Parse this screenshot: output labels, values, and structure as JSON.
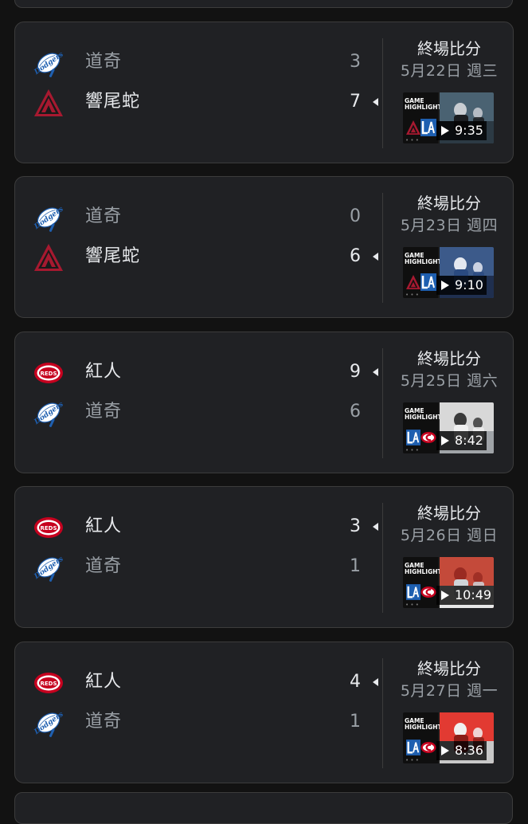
{
  "colors": {
    "background": "#121212",
    "card": "#202124",
    "border": "#3c3c3c",
    "text_primary": "#e8eaed",
    "text_secondary": "#9aa0a6",
    "dodgers_blue": "#1e5fb0",
    "dbacks_red": "#a71930",
    "reds_red": "#c6011f"
  },
  "games": [
    {
      "teams": [
        {
          "name": "道奇",
          "score": "3",
          "logo": "dodgers-logo",
          "winner": false
        },
        {
          "name": "響尾蛇",
          "score": "7",
          "logo": "diamondbacks-logo",
          "winner": true
        }
      ],
      "status": "終場比分",
      "date": "5月22日 週三",
      "video": {
        "badge": "GAME HIGHLIGHTS",
        "duration": "9:35",
        "logos": [
          "diamondbacks",
          "dodgers"
        ]
      }
    },
    {
      "teams": [
        {
          "name": "道奇",
          "score": "0",
          "logo": "dodgers-logo",
          "winner": false
        },
        {
          "name": "響尾蛇",
          "score": "6",
          "logo": "diamondbacks-logo",
          "winner": true
        }
      ],
      "status": "終場比分",
      "date": "5月23日 週四",
      "video": {
        "badge": "GAME HIGHLIGHTS",
        "duration": "9:10",
        "logos": [
          "diamondbacks",
          "dodgers"
        ]
      }
    },
    {
      "teams": [
        {
          "name": "紅人",
          "score": "9",
          "logo": "reds-logo",
          "winner": true
        },
        {
          "name": "道奇",
          "score": "6",
          "logo": "dodgers-logo",
          "winner": false
        }
      ],
      "status": "終場比分",
      "date": "5月25日 週六",
      "video": {
        "badge": "GAME HIGHLIGHTS",
        "duration": "8:42",
        "logos": [
          "dodgers",
          "reds"
        ]
      }
    },
    {
      "teams": [
        {
          "name": "紅人",
          "score": "3",
          "logo": "reds-logo",
          "winner": true
        },
        {
          "name": "道奇",
          "score": "1",
          "logo": "dodgers-logo",
          "winner": false
        }
      ],
      "status": "終場比分",
      "date": "5月26日 週日",
      "video": {
        "badge": "GAME HIGHLIGHTS",
        "duration": "10:49",
        "logos": [
          "dodgers",
          "reds"
        ]
      }
    },
    {
      "teams": [
        {
          "name": "紅人",
          "score": "4",
          "logo": "reds-logo",
          "winner": true
        },
        {
          "name": "道奇",
          "score": "1",
          "logo": "dodgers-logo",
          "winner": false
        }
      ],
      "status": "終場比分",
      "date": "5月27日 週一",
      "video": {
        "badge": "GAME HIGHLIGHTS",
        "duration": "8:36",
        "logos": [
          "dodgers",
          "reds"
        ]
      }
    }
  ]
}
